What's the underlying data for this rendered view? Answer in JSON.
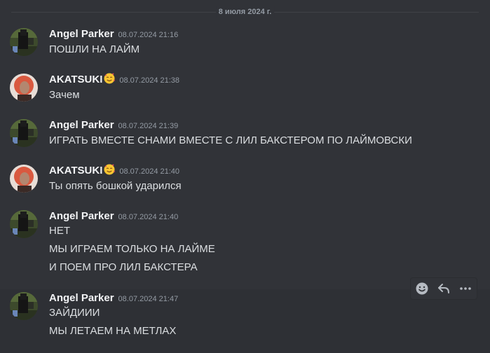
{
  "date_divider": "8 июля 2024 г.",
  "colors": {
    "background": "#313338",
    "text": "#dbdee1",
    "muted": "#949ba4"
  },
  "messages": [
    {
      "author": "Angel Parker",
      "time": "08.07.2024 21:16",
      "lines": [
        "ПОШЛИ НА ЛАЙМ"
      ]
    },
    {
      "author": "AKATSUKI",
      "time": "08.07.2024 21:38",
      "lines": [
        "Зачем"
      ],
      "badge_icon": "smiling-face-with-hearts-icon"
    },
    {
      "author": "Angel Parker",
      "time": "08.07.2024 21:39",
      "lines": [
        "ИГРАТЬ ВМЕСТЕ СНАМИ ВМЕСТЕ С ЛИЛ БАКСТЕРОМ ПО ЛАЙМОВСКИ"
      ]
    },
    {
      "author": "AKATSUKI",
      "time": "08.07.2024 21:40",
      "lines": [
        "Ты опять бошкой ударился"
      ],
      "badge_icon": "smiling-face-with-hearts-icon"
    },
    {
      "author": "Angel Parker",
      "time": "08.07.2024 21:40",
      "lines": [
        "НЕТ",
        "МЫ ИГРАЕМ ТОЛЬКО НА ЛАЙМЕ",
        "И ПОЕМ ПРО ЛИЛ БАКСТЕРА"
      ]
    },
    {
      "author": "Angel Parker",
      "time": "08.07.2024 21:47",
      "lines": [
        "ЗАЙДИИИ",
        "МЫ ЛЕТАЕМ НА МЕТЛАХ"
      ]
    }
  ],
  "toolbar_icons": [
    "add-reaction-icon",
    "reply-icon",
    "more-icon"
  ]
}
